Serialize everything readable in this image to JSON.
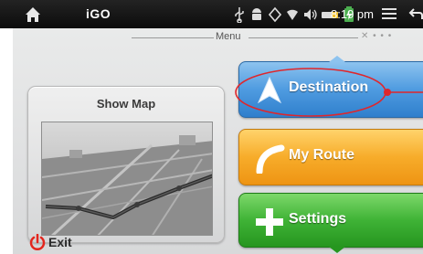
{
  "status_bar": {
    "app_title": "iGO",
    "time": "8:19 pm",
    "icons": [
      "home-icon",
      "usb-icon",
      "android-debug-icon",
      "gps-icon",
      "wifi-icon",
      "volume-icon",
      "battery-icon",
      "battery-charging-icon",
      "menu-icon",
      "back-icon"
    ]
  },
  "header": {
    "title": "Menu"
  },
  "map_card": {
    "label": "Show Map"
  },
  "menu_buttons": [
    {
      "label": "Destination",
      "icon": "navigation-arrow-icon",
      "color": "#4f9be0"
    },
    {
      "label": "My Route",
      "icon": "route-curve-icon",
      "color": "#f7ac2a"
    },
    {
      "label": "Settings",
      "icon": "plus-icon",
      "color": "#3fb336"
    }
  ],
  "footer": {
    "exit_label": "Exit",
    "exit_icon": "power-icon"
  },
  "annotation": {
    "color": "#e0262b"
  }
}
